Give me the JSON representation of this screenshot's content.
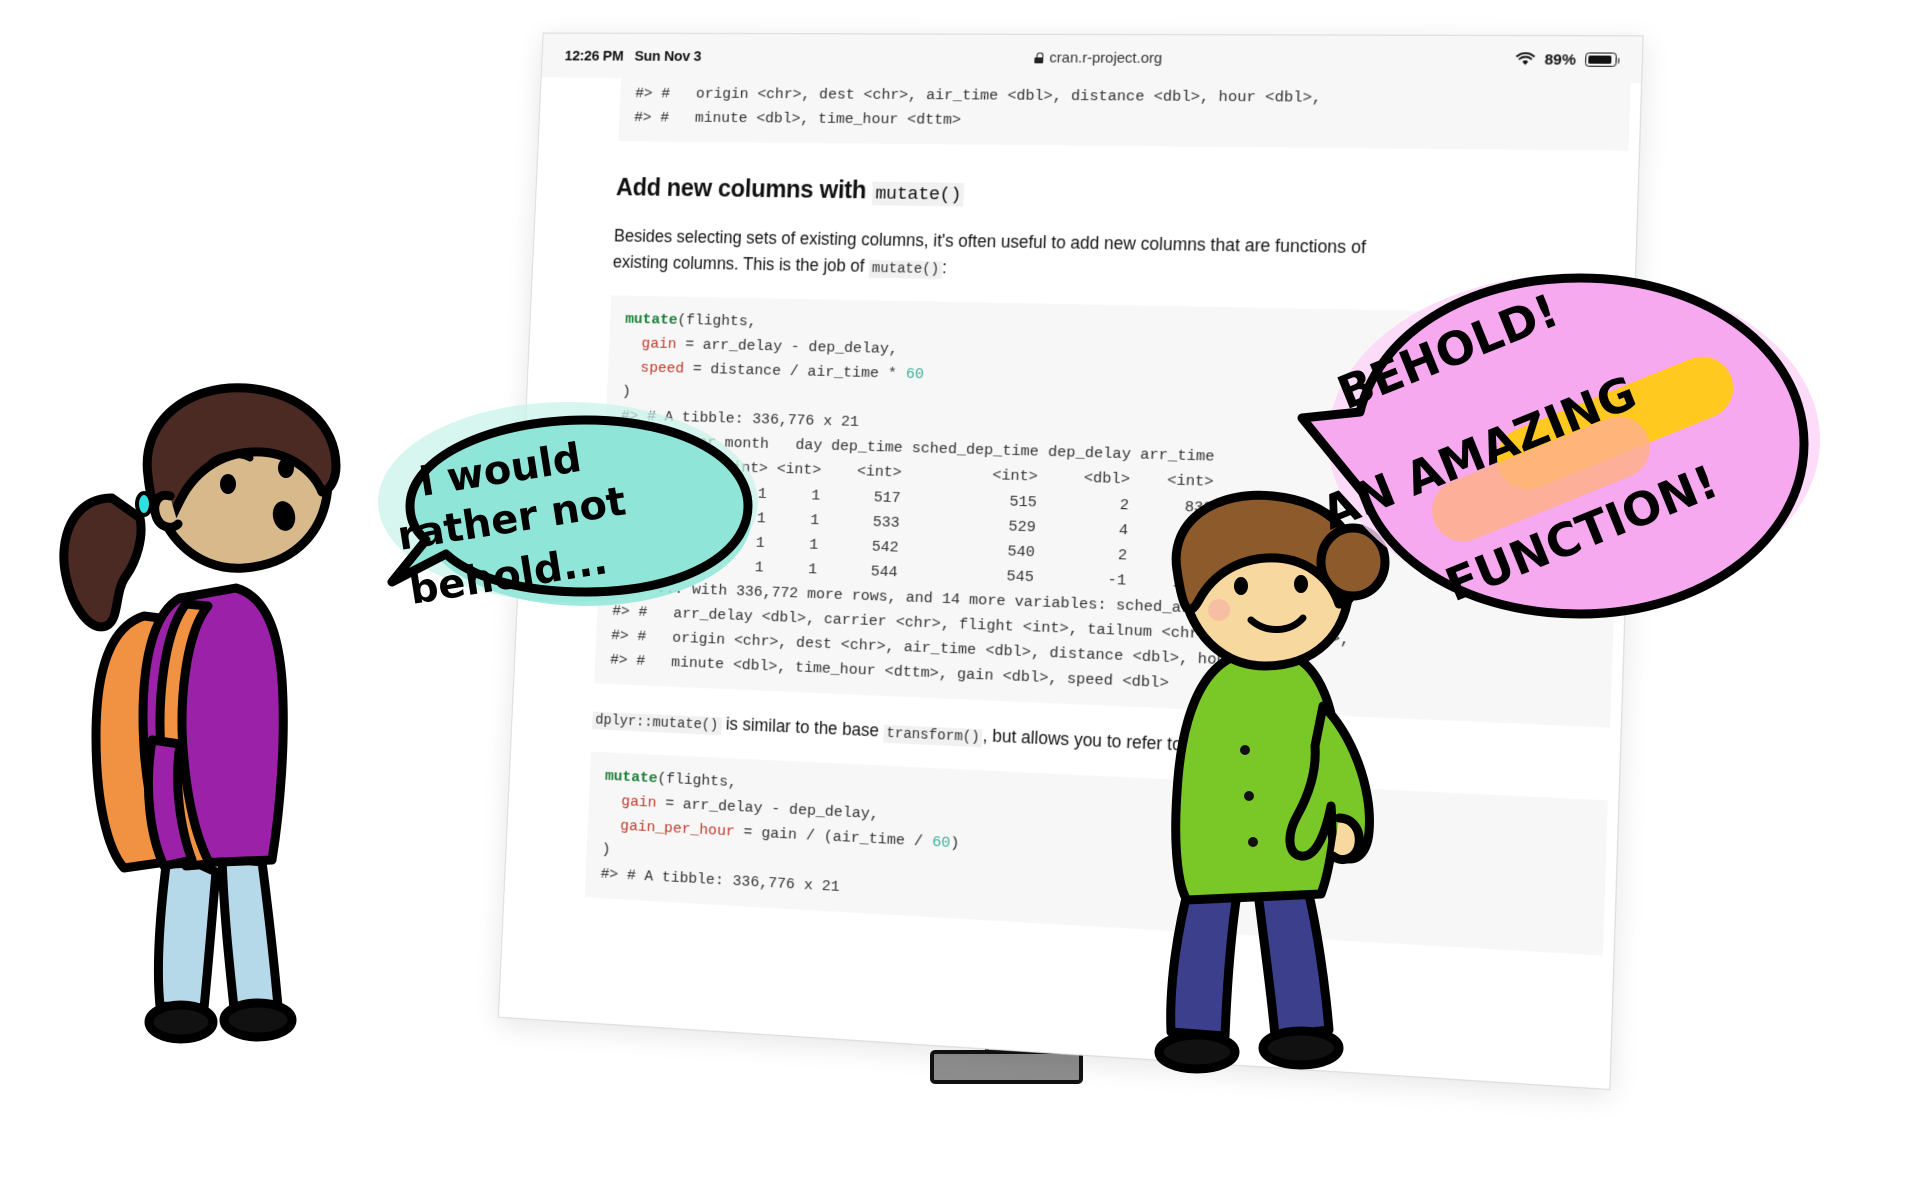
{
  "device": {
    "status_bar": {
      "time": "12:26 PM",
      "date": "Sun Nov 3",
      "url": "cran.r-project.org",
      "lock_icon": "lock-icon",
      "wifi_icon": "wifi-icon",
      "battery_percent": "89%",
      "battery_icon": "battery-icon"
    }
  },
  "page": {
    "top_output": [
      "#> #   origin <chr>, dest <chr>, air_time <dbl>, distance <dbl>, hour <dbl>,",
      "#> #   minute <dbl>, time_hour <dttm>"
    ],
    "heading": {
      "text": "Add new columns with ",
      "code": "mutate()"
    },
    "paragraph": {
      "before": "Besides selecting sets of existing columns, it's often useful to add new columns that are functions of existing columns. This is the job of ",
      "code": "mutate()",
      "after": ":"
    },
    "code_block_1": [
      {
        "t": "kw",
        "v": "mutate"
      },
      {
        "t": "plain",
        "v": "(flights,"
      }
    ],
    "code_1_lines": [
      "mutate(flights,",
      "  gain = arr_delay - dep_delay,",
      "  speed = distance / air_time * 60",
      ")"
    ],
    "output_1": [
      "#> # A tibble: 336,776 x 21",
      "#>     year month   day dep_time sched_dep_time dep_delay arr_time",
      "#>    <int> <int> <int>    <int>          <int>     <dbl>    <int>",
      "#>  1  2013     1     1      517            515         2      830",
      "#>  2  2013     1     1      533            529         4      850",
      "#>  3  2013     1     1      542            540         2      923",
      "#>  4  2013     1     1      544            545        -1     1004",
      "#> # ... with 336,772 more rows, and 14 more variables: sched_arr_time <int>,",
      "#> #   arr_delay <dbl>, carrier <chr>, flight <int>, tailnum <chr>, origin <chr>,",
      "#> #   origin <chr>, dest <chr>, air_time <dbl>, distance <dbl>, hour <dbl>,",
      "#> #   minute <dbl>, time_hour <dttm>, gain <dbl>, speed <dbl>"
    ],
    "paragraph_2": {
      "code1": "dplyr::mutate()",
      "mid1": " is similar to the base ",
      "code2": "transform()",
      "mid2": ", but allows you to refer to columns"
    },
    "code_2_lines": [
      "mutate(flights,",
      "  gain = arr_delay - dep_delay,",
      "  gain_per_hour = gain / (air_time / 60)",
      ")"
    ],
    "output_2": [
      "#> # A tibble: 336,776 x 21"
    ]
  },
  "characters": {
    "left": {
      "name": "student-skeptical",
      "speech": {
        "line1": "i would",
        "line2": "rather not",
        "line3": "behold..."
      },
      "bubble_color": "#9de8dd",
      "shirt_color": "#9b21a8",
      "backpack_color": "#f09241",
      "pants_color": "#b5d9e8",
      "hair_color": "#4a2a22",
      "skin_color": "#d8b98c"
    },
    "right": {
      "name": "student-excited",
      "speech": {
        "line1": "BEHOLD!",
        "line2": "AN AMAZING",
        "line3": "FUNCTION!"
      },
      "bubble_color": "#f7a9f0",
      "highlight_yellow": "#ffc91f",
      "highlight_orange": "#ffb08a",
      "shirt_color": "#7ac828",
      "pants_color": "#3b3f8c",
      "hair_color": "#8c5a2b",
      "skin_color": "#f7d9a0"
    }
  }
}
